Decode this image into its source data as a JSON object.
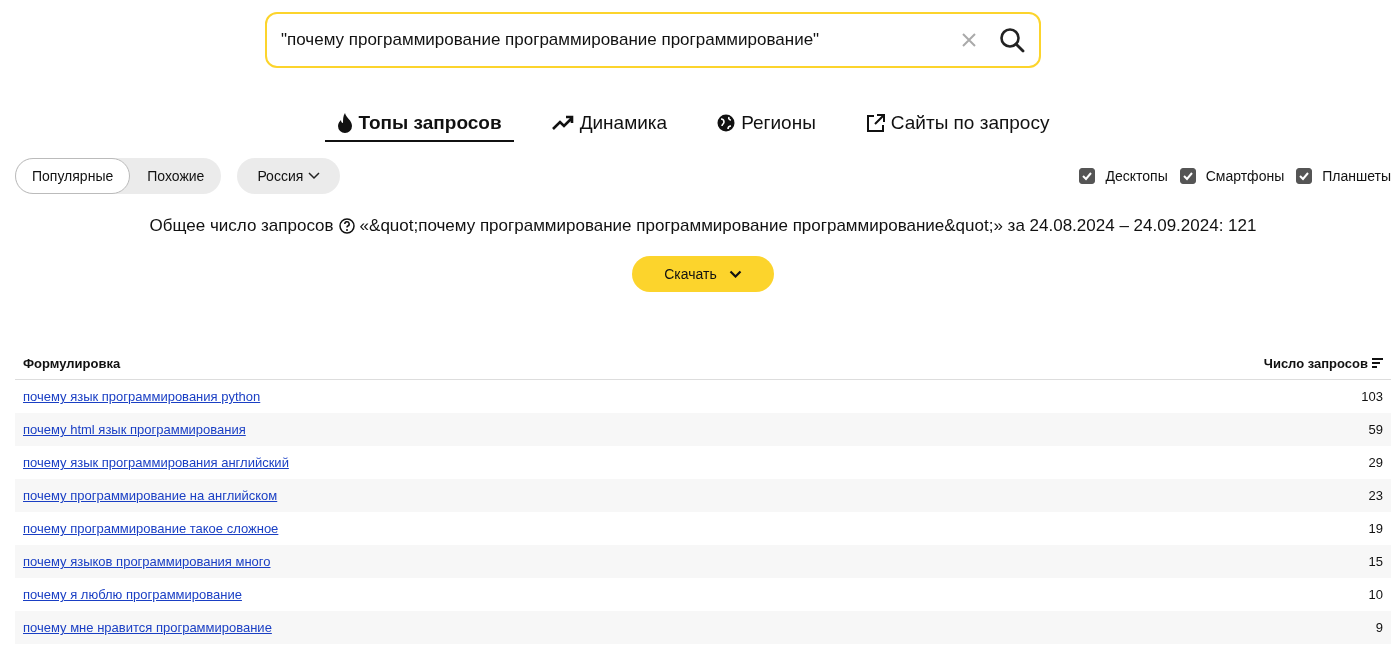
{
  "search": {
    "value": "\"почему программирование программирование программирование\""
  },
  "tabs": [
    {
      "label": "Топы запросов",
      "kind": "fire",
      "selected": true
    },
    {
      "label": "Динамика",
      "kind": "trend",
      "selected": false
    },
    {
      "label": "Регионы",
      "kind": "globe",
      "selected": false
    },
    {
      "label": "Сайты по запросу",
      "kind": "external",
      "selected": false
    }
  ],
  "modes": [
    {
      "label": "Популярные",
      "selected": true
    },
    {
      "label": "Похожие",
      "selected": false
    }
  ],
  "region": {
    "label": "Россия"
  },
  "devices": [
    {
      "label": "Десктопы",
      "checked": true
    },
    {
      "label": "Смартфоны",
      "checked": true
    },
    {
      "label": "Планшеты",
      "checked": true
    }
  ],
  "summary": {
    "label": "Общее число запросов",
    "text": "«&quot;почему программирование программирование программирование&quot;» за 24.08.2024 – 24.09.2024: 121"
  },
  "download": {
    "label": "Скачать"
  },
  "table": {
    "columns": [
      "Формулировка",
      "Число запросов"
    ],
    "rows": [
      {
        "query": "почему язык программирования python",
        "count": "103"
      },
      {
        "query": "почему html язык программирования",
        "count": "59"
      },
      {
        "query": "почему язык программирования английский",
        "count": "29"
      },
      {
        "query": "почему программирование на английском",
        "count": "23"
      },
      {
        "query": "почему программирование такое сложное",
        "count": "19"
      },
      {
        "query": "почему языков программирования много",
        "count": "15"
      },
      {
        "query": "почему я люблю программирование",
        "count": "10"
      },
      {
        "query": "почему мне нравится программирование",
        "count": "9"
      }
    ]
  }
}
